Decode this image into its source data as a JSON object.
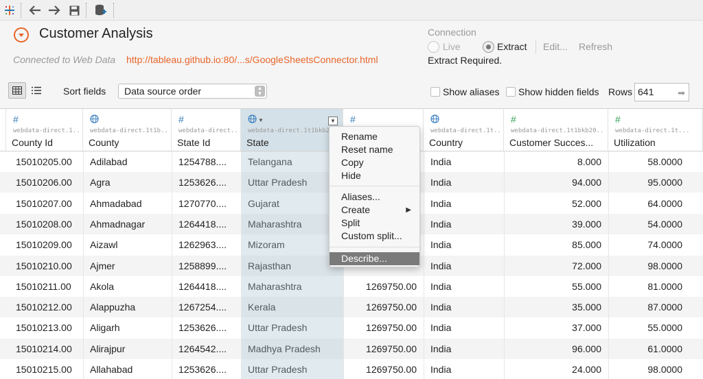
{
  "toolbar": {
    "items": [
      "tableau-logo-icon",
      "back-arrow-icon",
      "forward-arrow-icon",
      "save-icon",
      "add-data-source-icon"
    ]
  },
  "header": {
    "title": "Customer Analysis",
    "connected_label": "Connected to Web Data",
    "connected_url": "http://tableau.github.io:80/...s/GoogleSheetsConnector.html",
    "connection": {
      "label": "Connection",
      "live": "Live",
      "extract": "Extract",
      "selected": "Extract",
      "edit": "Edit...",
      "refresh": "Refresh",
      "status": "Extract Required."
    },
    "sort_label": "Sort fields",
    "sort_value": "Data source order",
    "show_aliases": "Show aliases",
    "show_hidden_fields": "Show hidden fields",
    "rows_label": "Rows",
    "rows_value": "641"
  },
  "columns": [
    {
      "icon": "#",
      "type": "number",
      "source": "webdata-direct.1...",
      "name": "County Id"
    },
    {
      "icon": "globe",
      "type": "geo",
      "source": "webdata-direct.1t1b...",
      "name": "County"
    },
    {
      "icon": "#",
      "type": "number",
      "source": "webdata-direct....",
      "name": "State Id"
    },
    {
      "icon": "globe",
      "type": "geo",
      "source": "webdata-direct.1t1bkb2",
      "name": "State"
    },
    {
      "icon": "#",
      "type": "number",
      "source": "",
      "name": ""
    },
    {
      "icon": "globe",
      "type": "geo",
      "source": "webdata-direct.1t...",
      "name": "Country"
    },
    {
      "icon": "#",
      "type": "number-green",
      "source": "webdata-direct.1t1bkb20...",
      "name": "Customer Succes..."
    },
    {
      "icon": "#",
      "type": "number-green",
      "source": "webdata-direct.1t...",
      "name": "Utilization"
    }
  ],
  "rows": [
    [
      "15010205.00",
      "Adilabad",
      "1254788....",
      "Telangana",
      "",
      "India",
      "8.000",
      "58.0000"
    ],
    [
      "15010206.00",
      "Agra",
      "1253626....",
      "Uttar Pradesh",
      "",
      "India",
      "94.000",
      "95.0000"
    ],
    [
      "15010207.00",
      "Ahmadabad",
      "1270770....",
      "Gujarat",
      "",
      "India",
      "52.000",
      "64.0000"
    ],
    [
      "15010208.00",
      "Ahmadnagar",
      "1264418....",
      "Maharashtra",
      "",
      "India",
      "39.000",
      "54.0000"
    ],
    [
      "15010209.00",
      "Aizawl",
      "1262963....",
      "Mizoram",
      "",
      "India",
      "85.000",
      "74.0000"
    ],
    [
      "15010210.00",
      "Ajmer",
      "1258899....",
      "Rajasthan",
      "",
      "India",
      "72.000",
      "98.0000"
    ],
    [
      "15010211.00",
      "Akola",
      "1264418....",
      "Maharashtra",
      "1269750.00",
      "India",
      "55.000",
      "81.0000"
    ],
    [
      "15010212.00",
      "Alappuzha",
      "1267254....",
      "Kerala",
      "1269750.00",
      "India",
      "35.000",
      "87.0000"
    ],
    [
      "15010213.00",
      "Aligarh",
      "1253626....",
      "Uttar Pradesh",
      "1269750.00",
      "India",
      "37.000",
      "55.0000"
    ],
    [
      "15010214.00",
      "Alirajpur",
      "1264542....",
      "Madhya Pradesh",
      "1269750.00",
      "India",
      "96.000",
      "61.0000"
    ],
    [
      "15010215.00",
      "Allahabad",
      "1253626....",
      "Uttar Pradesh",
      "1269750.00",
      "India",
      "24.000",
      "98.0000"
    ]
  ],
  "context_menu": {
    "group1": [
      "Rename",
      "Reset name",
      "Copy",
      "Hide"
    ],
    "group2": [
      "Aliases...",
      "Create",
      "Split",
      "Custom split..."
    ],
    "group3": [
      "Describe..."
    ],
    "submenu_arrow": "▶"
  },
  "colors": {
    "accent": "#e8642a",
    "selected_column": "#d5e1e8",
    "geo_icon": "#3b7fbf",
    "measure_icon": "#3aa45a"
  }
}
